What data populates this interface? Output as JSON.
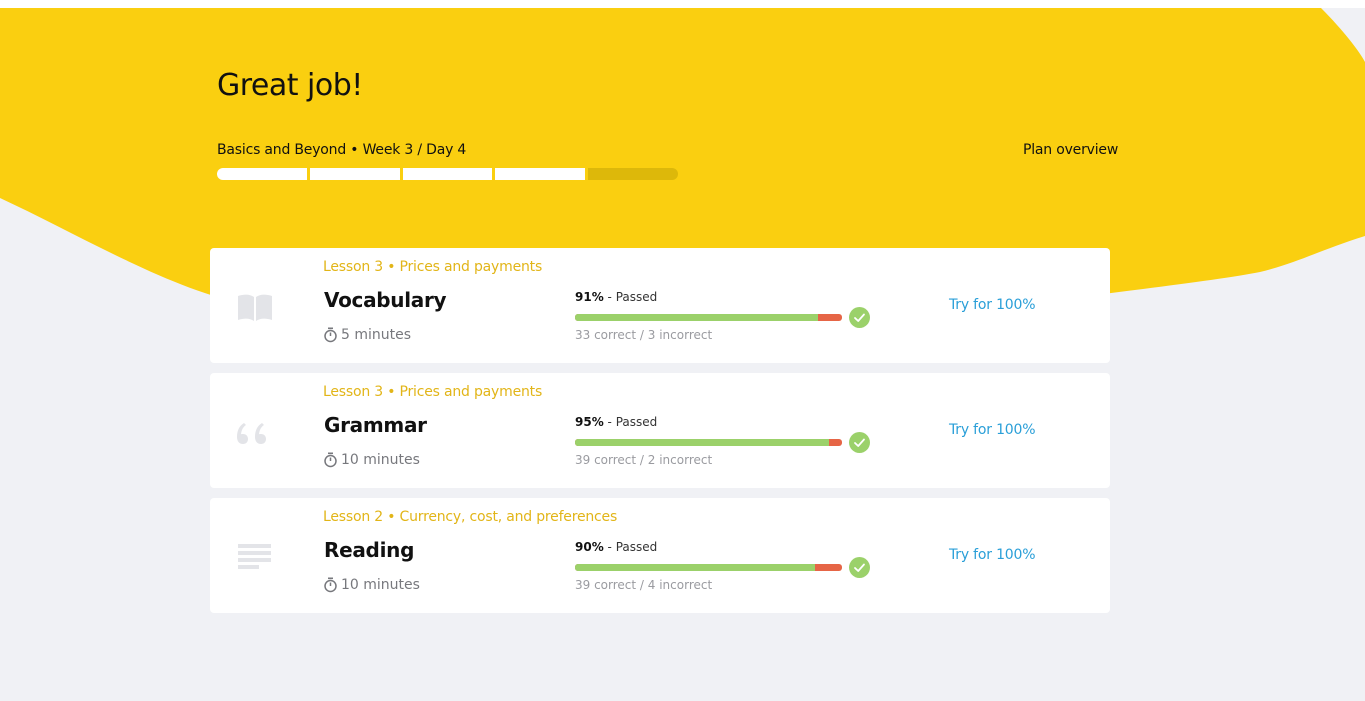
{
  "header": {
    "title": "Great job!",
    "plan": "Basics and Beyond • Week 3 / Day 4",
    "plan_overview": "Plan overview",
    "progress": {
      "completed_segments": 4,
      "total_segments": 5
    }
  },
  "colors": {
    "yellow": "#facf10",
    "passed_green": "#9bd16a",
    "incorrect_red": "#e66546",
    "link_blue": "#2a9fd8",
    "lesson_gold": "#e2b518",
    "background": "#f0f1f5"
  },
  "lessons": [
    {
      "lesson": "Lesson 3 • Prices and payments",
      "name": "Vocabulary",
      "duration": "5 minutes",
      "percent": "91%",
      "status": " - Passed",
      "score_fraction": 0.91,
      "counts": "33 correct / 3 incorrect",
      "retry": "Try for 100%",
      "icon": "book-icon"
    },
    {
      "lesson": "Lesson 3 • Prices and payments",
      "name": "Grammar",
      "duration": "10 minutes",
      "percent": "95%",
      "status": " - Passed",
      "score_fraction": 0.95,
      "counts": "39 correct / 2 incorrect",
      "retry": "Try for 100%",
      "icon": "quote-icon"
    },
    {
      "lesson": "Lesson 2 • Currency, cost, and preferences",
      "name": "Reading",
      "duration": "10 minutes",
      "percent": "90%",
      "status": " - Passed",
      "score_fraction": 0.9,
      "counts": "39 correct / 4 incorrect",
      "retry": "Try for 100%",
      "icon": "text-lines-icon"
    }
  ]
}
